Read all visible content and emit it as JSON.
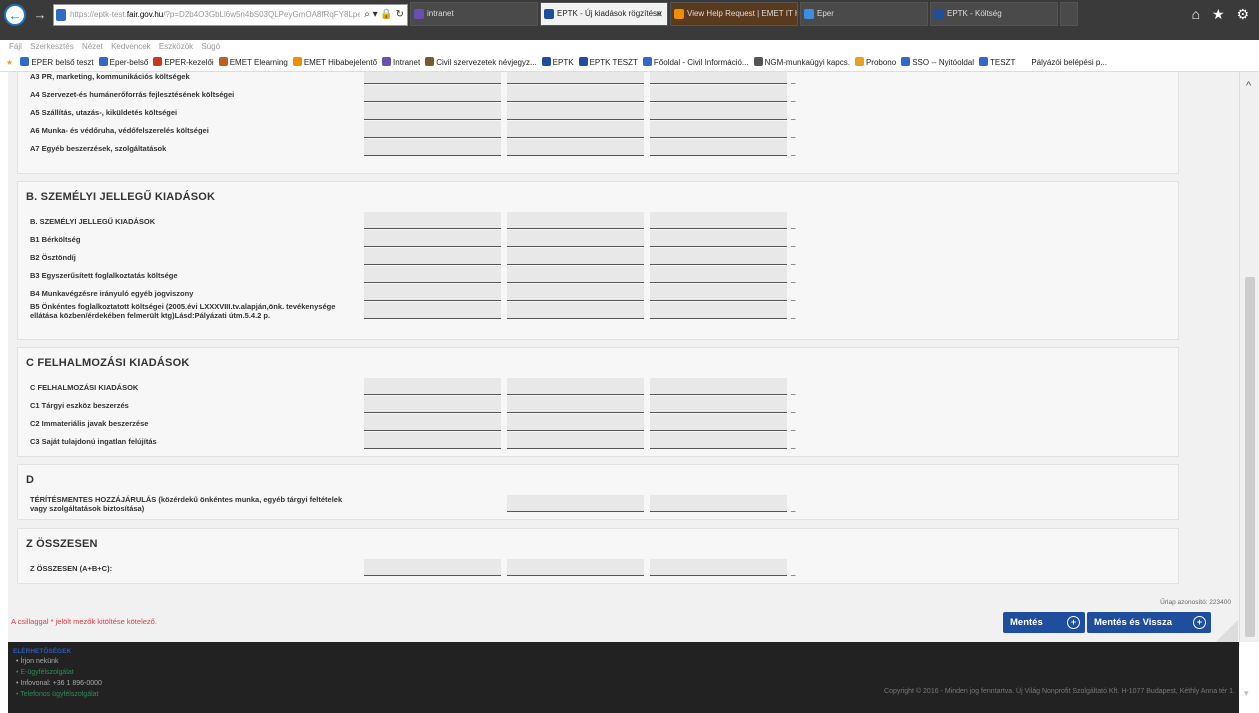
{
  "browser": {
    "url_prefix": "https://",
    "url_prefix_dim": "eptk-test.",
    "url_host": "fair.gov.hu",
    "url_rest": "/?p=D2b4O3GbLl6w5n4bS03QLPeyGmOA8fRqFY8LpeuR",
    "address_icons": "⌕ ▾ 🔒 ↻",
    "tabs": [
      {
        "label": "intranet",
        "color": "#6b4fb0"
      },
      {
        "label": "EPTK - Új kiadások rögzítése",
        "color": "#1f4e9e",
        "close": "✕"
      },
      {
        "label": "View Help Request | EMET IT H...",
        "color": "#f28c00"
      },
      {
        "label": "Eper",
        "color": "#3b8ee3"
      },
      {
        "label": "EPTK - Költség",
        "color": "#1f4e9e"
      }
    ],
    "right_icons": "⌂ ★ ⚙",
    "menu": [
      "Fájl",
      "Szerkesztés",
      "Nézet",
      "Kedvencek",
      "Eszközök",
      "Súgó"
    ],
    "favorites": [
      {
        "label": "EPER belső teszt",
        "color": "#2f6bc4"
      },
      {
        "label": "Eper-belső",
        "color": "#2f6bc4"
      },
      {
        "label": "EPER-kezelői",
        "color": "#c83a1c"
      },
      {
        "label": "EMET Elearning",
        "color": "#c06020"
      },
      {
        "label": "EMET Hibabejelentő",
        "color": "#f28c00"
      },
      {
        "label": "Intranet",
        "color": "#6b4fb0"
      },
      {
        "label": "Civil szervezetek névjegyz...",
        "color": "#7b5a2e"
      },
      {
        "label": "EPTK",
        "color": "#1f4e9e"
      },
      {
        "label": "EPTK TESZT",
        "color": "#1f4e9e"
      },
      {
        "label": "Főoldal - Civil Információ...",
        "color": "#2f6bc4"
      },
      {
        "label": "NGM-munkaügyi kapcs.",
        "color": "#555555"
      },
      {
        "label": "Probono",
        "color": "#e8a020"
      },
      {
        "label": "SSO -- Nyitóoldal",
        "color": "#2f6bc4"
      },
      {
        "label": "TESZT",
        "color": "#2f6bc4"
      },
      {
        "label": "Pályázói belépési p...",
        "color": "#ffffff"
      }
    ]
  },
  "sections": [
    {
      "title": "",
      "rows": [
        {
          "label": "A3 PR, marketing, kommunikációs költségek",
          "fields": 3
        },
        {
          "label": "A4 Szervezet-és humánerőforrás fejlesztésének költségei",
          "fields": 3
        },
        {
          "label": "A5 Szállítás, utazás-, kiküldetés költségei",
          "fields": 3
        },
        {
          "label": "A6 Munka- és védőruha, védőfelszerelés költségei",
          "fields": 3
        },
        {
          "label": "A7 Egyéb beszerzések, szolgáltatások",
          "fields": 3
        }
      ]
    },
    {
      "title": "B. SZEMÉLYI JELLEGŰ KIADÁSOK",
      "rows": [
        {
          "label": "B. SZEMÉLYI JELLEGŰ KIADÁSOK",
          "fields": 3
        },
        {
          "label": "B1 Bérköltség",
          "fields": 3
        },
        {
          "label": "B2 Ösztöndíj",
          "fields": 3
        },
        {
          "label": "B3 Egyszerűsített foglalkoztatás költsége",
          "fields": 3
        },
        {
          "label": "B4 Munkavégzésre irányuló egyéb jogviszony",
          "fields": 3
        },
        {
          "label": "B5 Önkéntes foglalkoztatott költségei (2005.évi LXXXVIII.tv.alapján,önk. tevékenysége ellátása közben/érdekében felmerült ktg)Lásd:Pályázati útm.5.4.2 p.",
          "fields": 3
        }
      ]
    },
    {
      "title": "C FELHALMOZÁSI KIADÁSOK",
      "rows": [
        {
          "label": "C FELHALMOZÁSI KIADÁSOK",
          "fields": 3
        },
        {
          "label": "C1 Tárgyi eszköz beszerzés",
          "fields": 3
        },
        {
          "label": "C2 Immateriális javak beszerzése",
          "fields": 3
        },
        {
          "label": "C3 Saját tulajdonú ingatlan felújítás",
          "fields": 3
        }
      ]
    },
    {
      "title": "D",
      "rows": [
        {
          "label": "TÉRÍTÉSMENTES HOZZÁJÁRULÁS (közérdekű önkéntes munka, egyéb tárgyi feltételek vagy szolgáltatások biztosítása)",
          "fields": 2
        }
      ]
    },
    {
      "title": "Z ÖSSZESEN",
      "rows": [
        {
          "label": "Z ÖSSZESEN (A+B+C):",
          "fields": 3
        }
      ]
    }
  ],
  "row_suffix": "_",
  "form_id": "Űrlap azonosító: 223400",
  "required_note": "A csillaggal * jelölt mezők kitöltése kötelező.",
  "buttons": {
    "save": "Mentés",
    "save_back": "Mentés és Vissza",
    "plus": "+"
  },
  "footer": {
    "contacts_title": "ELÉRHETŐSÉGEK",
    "links": [
      {
        "label": "• Írjon nekünk",
        "color": "#aaaaaa"
      },
      {
        "label": "• E-ügyfélszolgálat",
        "color": "#2e8b57"
      },
      {
        "label": "• Infovonal: +36 1 896-0000",
        "color": "#aaaaaa"
      },
      {
        "label": "• Telefonos ügyfélszolgálat",
        "color": "#2e8b57"
      }
    ],
    "copyright": "Copyright © 2016 - Minden jog fenntartva. Új Világ Nonprofit Szolgáltató Kft. H-1077 Budapest, Kéthly Anna tér 1.",
    "scroll_icon": "▾"
  },
  "scroll_up_icon": "^"
}
